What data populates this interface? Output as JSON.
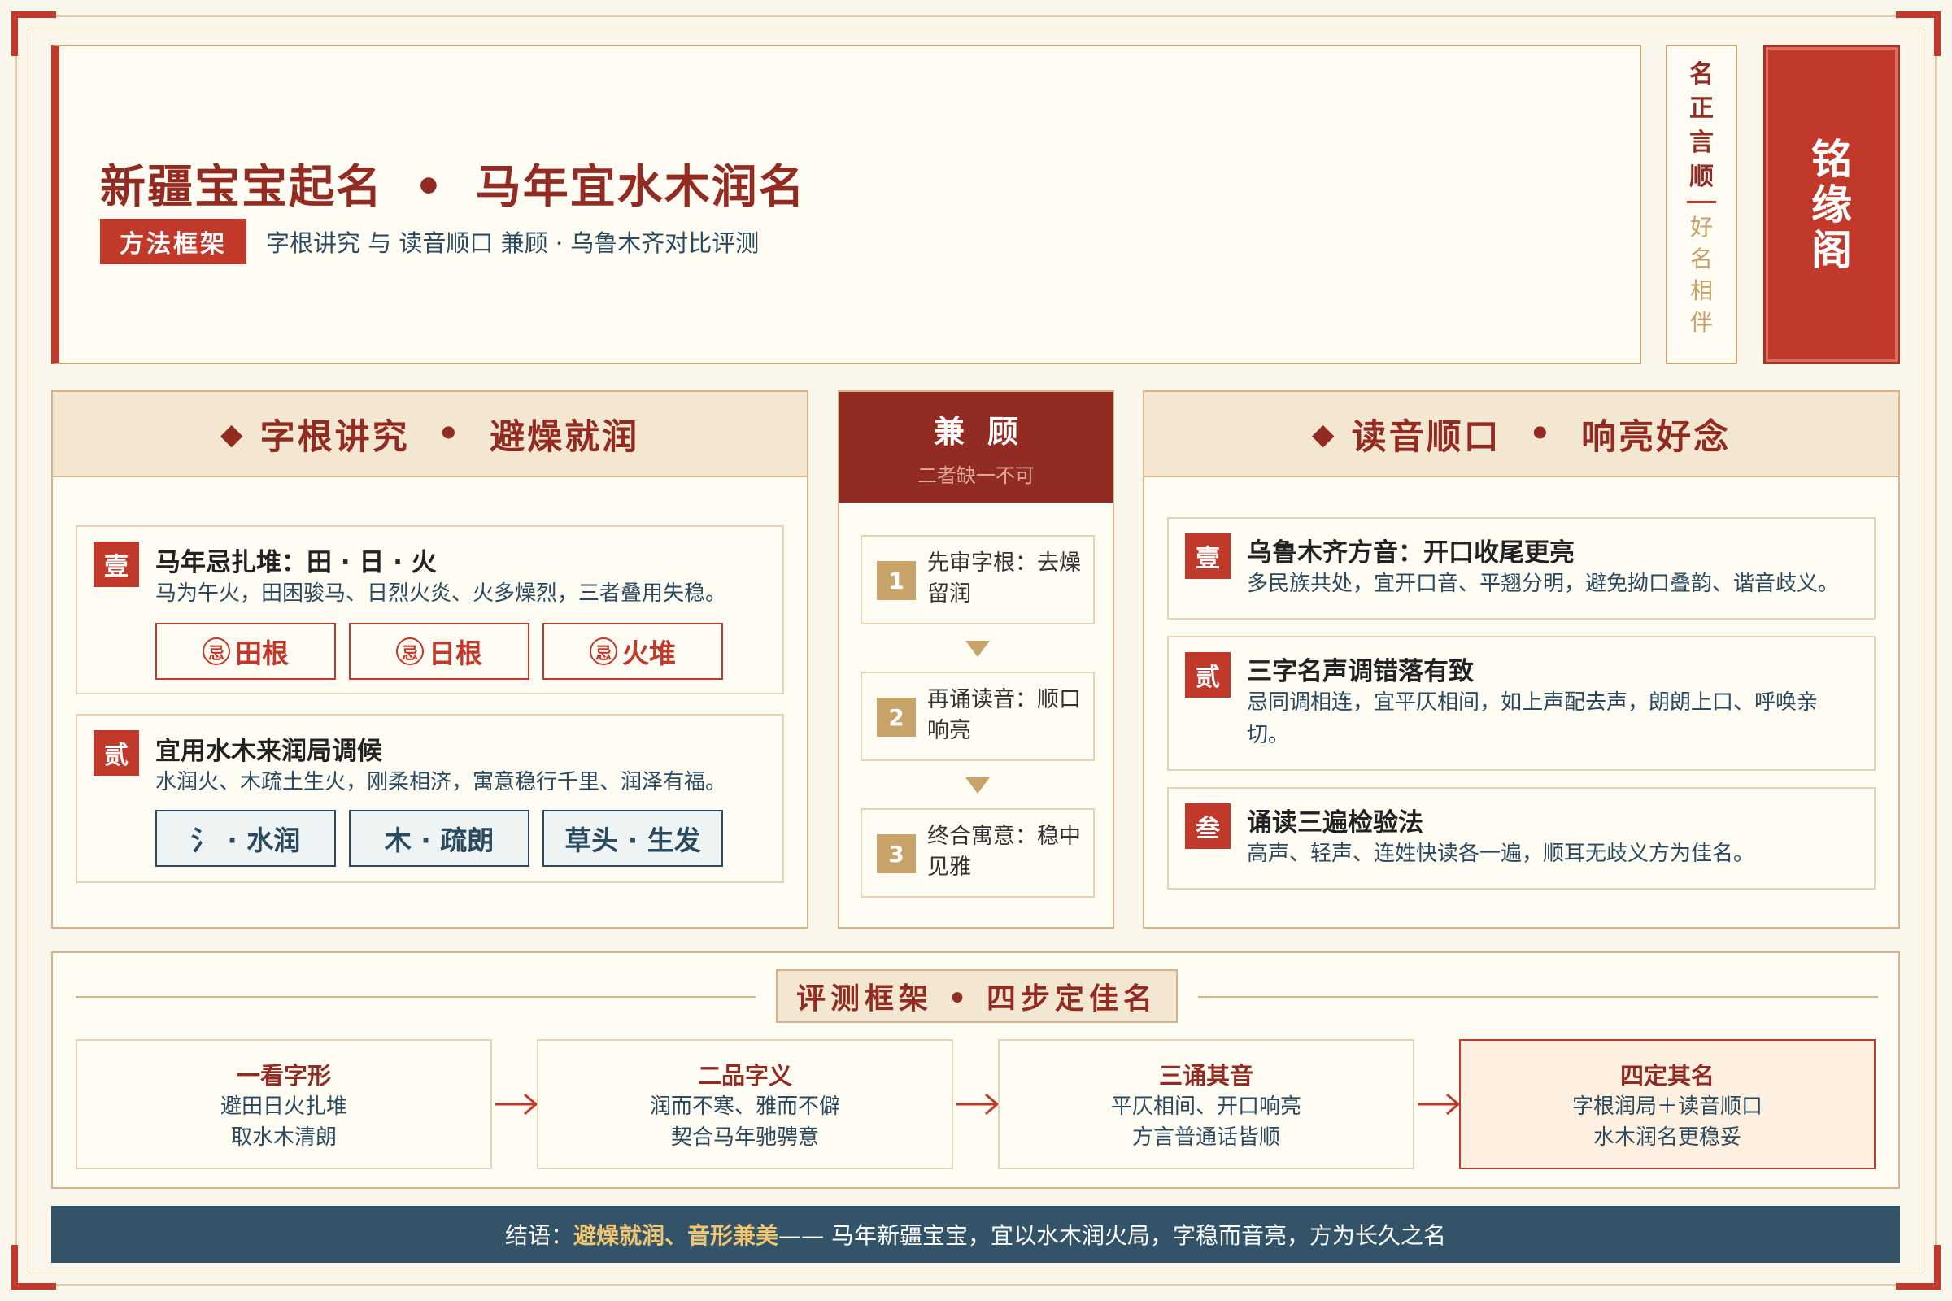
{
  "header": {
    "title_part1": "新疆宝宝起名",
    "title_dot": "•",
    "title_part2": "马年宜水木润名",
    "tag": "方法框架",
    "subtitle": "字根讲究 与 读音顺口 兼顾 · 乌鲁木齐对比评测"
  },
  "vertical_box": {
    "top_chars": [
      "名",
      "正",
      "言",
      "顺"
    ],
    "bottom_chars": [
      "好",
      "名",
      "相",
      "伴"
    ]
  },
  "seal": {
    "chars": [
      "铭",
      "缘",
      "阁"
    ]
  },
  "left_panel": {
    "title_a": "字根讲究",
    "dot": "•",
    "title_b": "避燥就润",
    "cards": [
      {
        "num": "壹",
        "title": "马年忌扎堆：田 · 日 · 火",
        "desc": "马为午火，田困骏马、日烈火炎、火多燥烈，三者叠用失稳。",
        "chips": [
          {
            "mark": "忌",
            "text": "田根"
          },
          {
            "mark": "忌",
            "text": "日根"
          },
          {
            "mark": "忌",
            "text": "火堆"
          }
        ]
      },
      {
        "num": "贰",
        "title": "宜用水木来润局调候",
        "desc": "水润火、木疏土生火，刚柔相济，寓意稳行千里、润泽有福。",
        "chips": [
          {
            "text": "氵 · 水润"
          },
          {
            "text": "木 · 疏朗"
          },
          {
            "text": "草头 · 生发"
          }
        ]
      }
    ]
  },
  "middle_panel": {
    "title": "兼顾",
    "subtitle": "二者缺一不可",
    "steps": [
      {
        "num": "1",
        "text": "先审字根：去燥留润"
      },
      {
        "num": "2",
        "text": "再诵读音：顺口响亮"
      },
      {
        "num": "3",
        "text": "终合寓意：稳中见雅"
      }
    ]
  },
  "right_panel": {
    "title_a": "读音顺口",
    "dot": "•",
    "title_b": "响亮好念",
    "cards": [
      {
        "num": "壹",
        "title": "乌鲁木齐方音：开口收尾更亮",
        "desc": "多民族共处，宜开口音、平翘分明，避免拗口叠韵、谐音歧义。"
      },
      {
        "num": "贰",
        "title": "三字名声调错落有致",
        "desc": "忌同调相连，宜平仄相间，如上声配去声，朗朗上口、呼唤亲切。"
      },
      {
        "num": "叁",
        "title": "诵读三遍检验法",
        "desc": "高声、轻声、连姓快读各一遍，顺耳无歧义方为佳名。"
      }
    ]
  },
  "bottom": {
    "title": "评测框架 • 四步定佳名",
    "steps": [
      {
        "title": "一看字形",
        "lines": [
          "避田日火扎堆",
          "取水木清朗"
        ]
      },
      {
        "title": "二品字义",
        "lines": [
          "润而不寒、雅而不僻",
          "契合马年驰骋意"
        ]
      },
      {
        "title": "三诵其音",
        "lines": [
          "平仄相间、开口响亮",
          "方言普通话皆顺"
        ]
      },
      {
        "title": "四定其名",
        "lines": [
          "字根润局＋读音顺口",
          "水木润名更稳妥"
        ]
      }
    ]
  },
  "footer": {
    "prefix": "结语：",
    "highlight": "避燥就润、音形兼美",
    "rest": " —— 马年新疆宝宝，宜以水木润火局，字稳而音亮，方为长久之名"
  },
  "colors": {
    "accent_red": "#c0392b",
    "dark_red": "#922b21",
    "gold": "#c9a46a",
    "navy": "#335468",
    "background": "#fbf6ec"
  }
}
